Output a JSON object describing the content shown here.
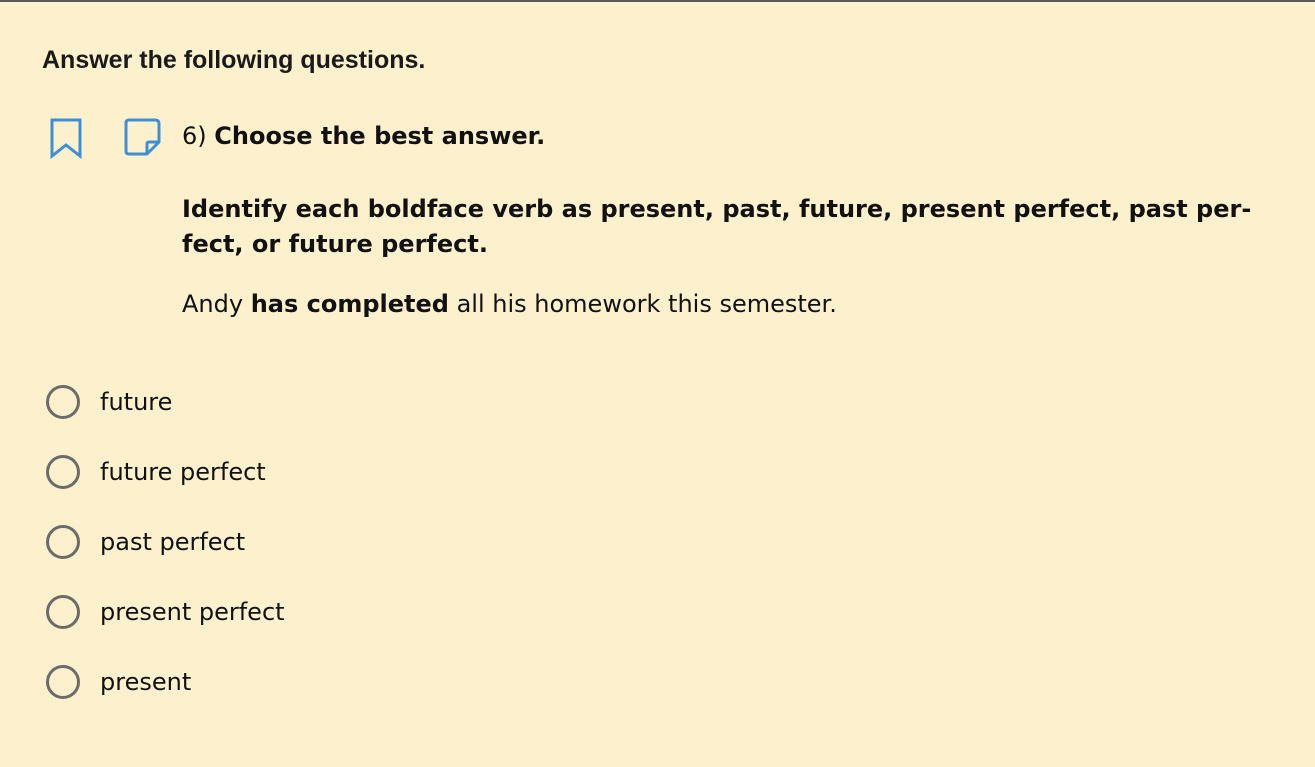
{
  "instructions": "Answer the following questions.",
  "question": {
    "number": "6)",
    "title": "Choose the best answer.",
    "directions": "Identify each boldface verb as present, past, future, present perfect, past per-fect, or future perfect.",
    "directions_line1": "Identify each boldface verb as present, past, future, present perfect, past per-",
    "directions_line2": "fect, or future perfect.",
    "sentence": {
      "before": "Andy ",
      "bold": "has completed",
      "after": " all his homework this semester."
    }
  },
  "options": [
    {
      "label": "future",
      "selected": false
    },
    {
      "label": "future perfect",
      "selected": false
    },
    {
      "label": "past perfect",
      "selected": false
    },
    {
      "label": "present perfect",
      "selected": false
    },
    {
      "label": "present",
      "selected": false
    }
  ],
  "icons": {
    "bookmark": "bookmark-icon",
    "note": "note-icon"
  },
  "colors": {
    "background": "#fdf0cd",
    "icon_blue": "#3d8fd6",
    "radio_border": "#6b6b6b"
  }
}
